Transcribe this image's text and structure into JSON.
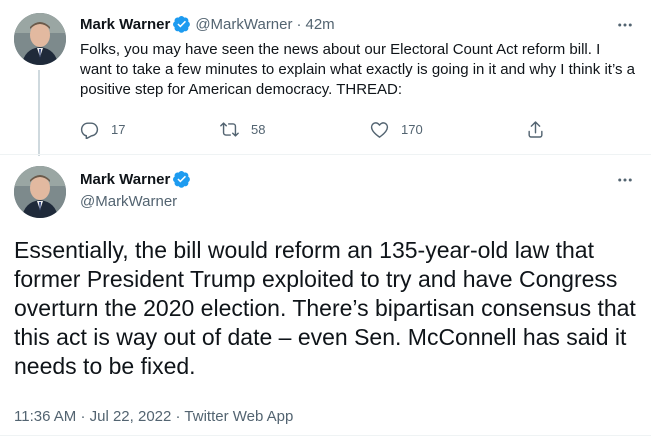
{
  "colors": {
    "text": "#0f1419",
    "secondary": "#536471",
    "verified": "#1d9bf0",
    "divider": "#eff3f4",
    "thread_line": "#cfd9de"
  },
  "thread_tweet": {
    "author_name": "Mark Warner",
    "handle": "@MarkWarner",
    "separator": "·",
    "time": "42m",
    "text": "Folks, you may have seen the news about our Electoral Count Act reform bill. I want to take a few minutes to explain what exactly is going in it and why I think it’s a positive step for American democracy. THREAD:",
    "more_icon": "more-horizontal-icon",
    "actions": {
      "reply": {
        "icon": "reply-icon",
        "count": "17"
      },
      "retweet": {
        "icon": "retweet-icon",
        "count": "58"
      },
      "like": {
        "icon": "heart-icon",
        "count": "170"
      },
      "share": {
        "icon": "share-icon"
      }
    }
  },
  "main_tweet": {
    "author_name": "Mark Warner",
    "handle": "@MarkWarner",
    "more_icon": "more-horizontal-icon",
    "text": "Essentially, the bill would reform an 135-year-old law that former President Trump exploited to try and have Congress overturn the 2020 election. There’s bipartisan consensus that this act is way out of date – even Sen. McConnell has said it needs to be fixed.",
    "time": "11:36 AM",
    "separator1": "·",
    "date": "Jul 22, 2022",
    "separator2": "·",
    "source": "Twitter Web App"
  }
}
